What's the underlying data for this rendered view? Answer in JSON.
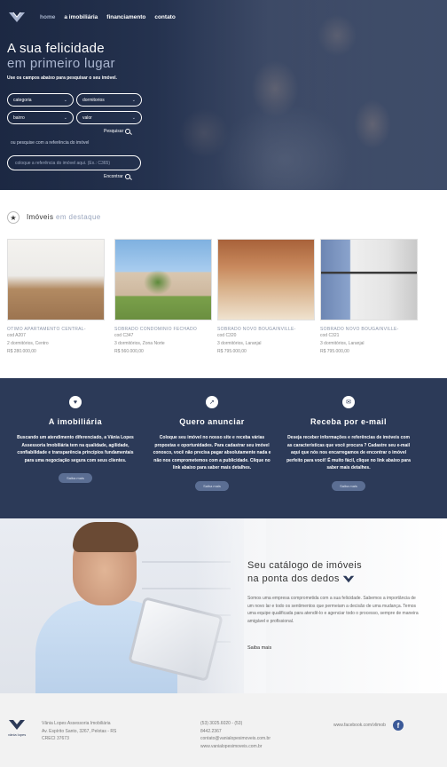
{
  "nav": {
    "items": [
      "home",
      "a imobiliária",
      "financiamento",
      "contato"
    ],
    "active": 0
  },
  "hero": {
    "title": "A sua felicidade",
    "subtitle": "em primeiro lugar",
    "hint": "Use os campos abaixo para pesquisar o seu imóvel.",
    "selects": {
      "categoria": "categoria",
      "dormitorios": "dormitorios",
      "bairro": "bairro",
      "valor": "valor"
    },
    "search_label": "Pesquisar",
    "ref_hint": "ou pesquise com a referência do imóvel",
    "ref_placeholder": "coloque a referência do imóvel aqui. (Ex.: C365)",
    "find_label": "Encontrar"
  },
  "featured": {
    "title": "Imóveis",
    "title_accent": "em destaque",
    "cards": [
      {
        "name": "OTIMO APARTAMENTO CENTRAL-",
        "code": "cod A207",
        "details": "2 dormitórios, Centro",
        "price": "R$ 280.000,00"
      },
      {
        "name": "SOBRADO CONDOMINIO FECHADO",
        "code": "cod C347",
        "details": "3 dormitórios, Zona Norte",
        "price": "R$ 560.000,00"
      },
      {
        "name": "SOBRADO NOVO BOUGAINVILLE-",
        "code": "cod C320",
        "details": "3 dormitórios, Laranjal",
        "price": "R$ 795.000,00"
      },
      {
        "name": "SOBRADO NOVO BOUGAINVILLE-",
        "code": "cod C321",
        "details": "3 dormitórios, Laranjal",
        "price": "R$ 795.000,00"
      }
    ]
  },
  "info": {
    "columns": [
      {
        "icon": "heart-icon",
        "title": "A imobiliária",
        "text": "Buscando um atendimento diferenciado, a Vânia Lopes Assessoria Imobiliária tem na qualidade, agilidade, confiabilidade e transparência princípios fundamentais para uma negociação segura com seus clientes.",
        "button": "Saiba mais"
      },
      {
        "icon": "cursor-icon",
        "title": "Quero anunciar",
        "text": "Coloque seu imóvel no nosso site e receba várias propostas e oportunidades. Para cadastrar seu imóvel conosco, você não precisa pagar absolutamente nada e não nos comprometemos com a publicidade. Clique no link abaixo para saber mais detalhes.",
        "button": "Saiba mais"
      },
      {
        "icon": "mail-icon",
        "title": "Receba por e-mail",
        "text": "Deseja receber informações e referências de imóveis com as características que você procura ? Cadastre seu e-mail aqui que nós nos encarregamos de encontrar o imóvel perfeito para você! É muito fácil, clique no link abaixo para saber mais detalhes.",
        "button": "Saiba mais"
      }
    ]
  },
  "promo": {
    "title_line1": "Seu catálogo de imóveis",
    "title_line2": "na ponta dos dedos",
    "text": "Somos uma empresa comprometida com a sua felicidade. Sabemos a importância de um novo lar e todo os sentimentos que permeiam a decisão de uma mudança. Temos uma equipe qualificada para atendê-lo e agenciar todo o processo, sempre de maneira amigável e profissional.",
    "more": "Saiba mais"
  },
  "footer": {
    "logo_text": "vânia lopes",
    "company": "Vânia Lopes Assessoria Imobiliária",
    "address": "Av. Espírito Santo, 3267, Pelotas - RS",
    "creci": "CRECI 37673",
    "phone": "(53) 3025.6020 - (53)",
    "phone2": "8442.2367",
    "email": "contato@vanialopesimoveis.com.br",
    "site": "www.vanialopesimoveis.com.br",
    "facebook": "www.facebook.com/vlimob"
  },
  "colors": {
    "navy": "#2c3a58",
    "accent": "#a9b5cf",
    "facebook": "#3b5998"
  }
}
